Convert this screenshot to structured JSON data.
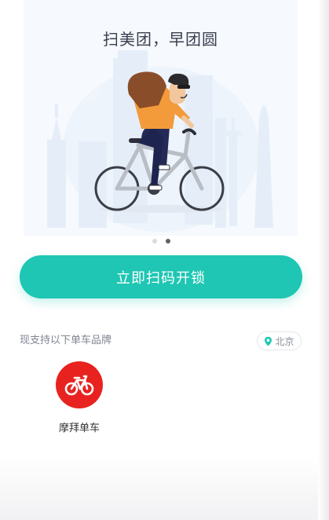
{
  "banner": {
    "title": "扫美团，早团圆",
    "illustration_icon": "cyclist-illustration",
    "pager_dots": 2,
    "active_dot": 2
  },
  "primary_action": {
    "label": "立即扫码开锁",
    "color": "#1ec6b3"
  },
  "brands": {
    "section_label": "现支持以下单车品牌",
    "city": {
      "label": "北京",
      "icon": "location-pin-icon"
    },
    "items": [
      {
        "name": "摩拜单车",
        "icon": "mobike-logo",
        "color": "#e8231f"
      }
    ]
  },
  "colors": {
    "accent": "#1ec6b3",
    "text_muted": "#808592",
    "banner_bg": "#f6f9fd"
  }
}
